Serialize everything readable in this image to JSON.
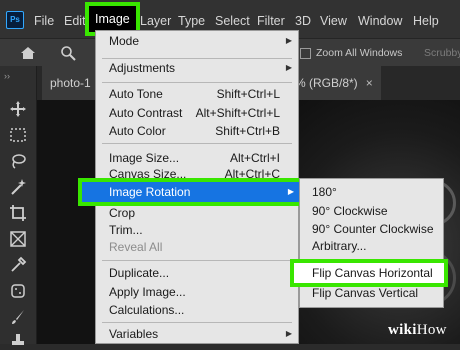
{
  "app": {
    "logo": "Ps"
  },
  "menubar": {
    "items": [
      "File",
      "Edit",
      "Image",
      "Layer",
      "Type",
      "Select",
      "Filter",
      "3D",
      "View",
      "Window",
      "Help"
    ]
  },
  "optionsbar": {
    "zoom_all_windows": "Zoom All Windows",
    "scrubby": "Scrubby"
  },
  "toolbar": {
    "expand": "››"
  },
  "tabs": {
    "tab1": "photo-1",
    "tab2_suffix": "% (RGB/8*)",
    "close": "×"
  },
  "image_menu": [
    {
      "label": "Mode",
      "submenu": true
    },
    {
      "sep": true
    },
    {
      "label": "Adjustments",
      "submenu": true
    },
    {
      "sep": true
    },
    {
      "label": "Auto Tone",
      "shortcut": "Shift+Ctrl+L"
    },
    {
      "label": "Auto Contrast",
      "shortcut": "Alt+Shift+Ctrl+L"
    },
    {
      "label": "Auto Color",
      "shortcut": "Shift+Ctrl+B"
    },
    {
      "sep": true
    },
    {
      "label": "Image Size...",
      "shortcut": "Alt+Ctrl+I"
    },
    {
      "label": "Canvas Size...",
      "shortcut": "Alt+Ctrl+C"
    },
    {
      "label": "Image Rotation",
      "submenu": true,
      "highlighted": true
    },
    {
      "label": "Crop"
    },
    {
      "label": "Trim..."
    },
    {
      "label": "Reveal All",
      "disabled": true
    },
    {
      "sep": true
    },
    {
      "label": "Duplicate..."
    },
    {
      "label": "Apply Image..."
    },
    {
      "label": "Calculations..."
    },
    {
      "sep": true
    },
    {
      "label": "Variables",
      "submenu": true
    }
  ],
  "rotation_submenu": {
    "items": [
      "180°",
      "90° Clockwise",
      "90° Counter Clockwise",
      "Arbitrary..."
    ],
    "flip_horizontal": "Flip Canvas Horizontal",
    "flip_vertical": "Flip Canvas Vertical"
  },
  "watermark": {
    "wiki": "wiki",
    "how": "How"
  },
  "colors": {
    "highlight_green": "#39e600",
    "menu_blue": "#1674e2",
    "ps_blue": "#31a8ff"
  }
}
